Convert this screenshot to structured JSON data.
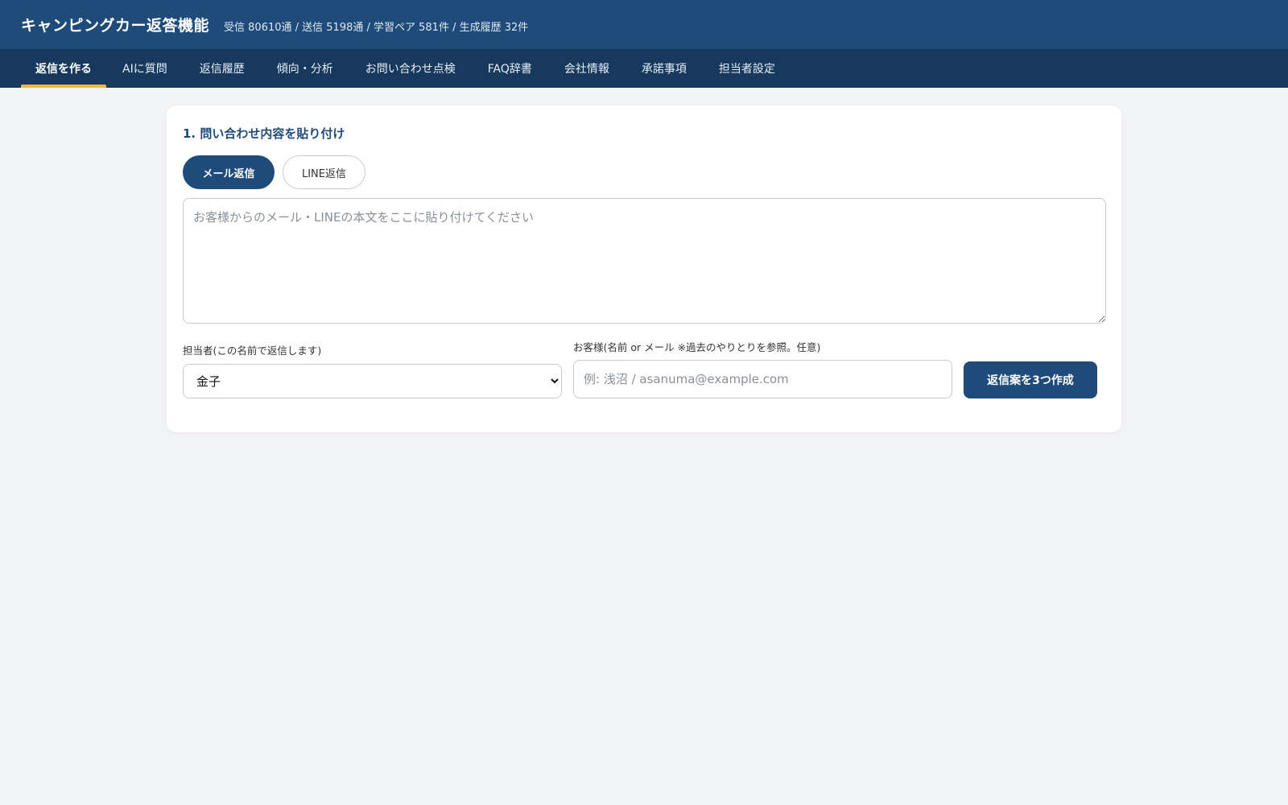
{
  "header": {
    "title": "キャンピングカー返答機能",
    "stats": "受信 80610通 / 送信 5198通 / 学習ペア 581件 / 生成履歴 32件"
  },
  "nav": {
    "tabs": [
      {
        "label": "返信を作る",
        "active": true
      },
      {
        "label": "AIに質問",
        "active": false
      },
      {
        "label": "返信履歴",
        "active": false
      },
      {
        "label": "傾向・分析",
        "active": false
      },
      {
        "label": "お問い合わせ点検",
        "active": false
      },
      {
        "label": "FAQ辞書",
        "active": false
      },
      {
        "label": "会社情報",
        "active": false
      },
      {
        "label": "承諾事項",
        "active": false
      },
      {
        "label": "担当者設定",
        "active": false
      }
    ]
  },
  "main": {
    "section_title": "1. 問い合わせ内容を貼り付け",
    "mode": {
      "email_label": "メール返信",
      "line_label": "LINE返信",
      "selected": "email"
    },
    "inquiry": {
      "placeholder": "お客様からのメール・LINEの本文をここに貼り付けてください",
      "value": ""
    },
    "staff": {
      "label": "担当者(この名前で返信します)",
      "selected": "金子"
    },
    "customer": {
      "label": "お客様(名前 or メール ※過去のやりとりを参照。任意)",
      "placeholder": "例: 浅沼 / asanuma@example.com",
      "value": ""
    },
    "generate_label": "返信案を3つ作成"
  },
  "colors": {
    "header_bg": "#1f4b7a",
    "nav_bg": "#17395d",
    "accent": "#f2b73c",
    "primary": "#1f4b7a",
    "page_bg": "#f2f3f5"
  }
}
